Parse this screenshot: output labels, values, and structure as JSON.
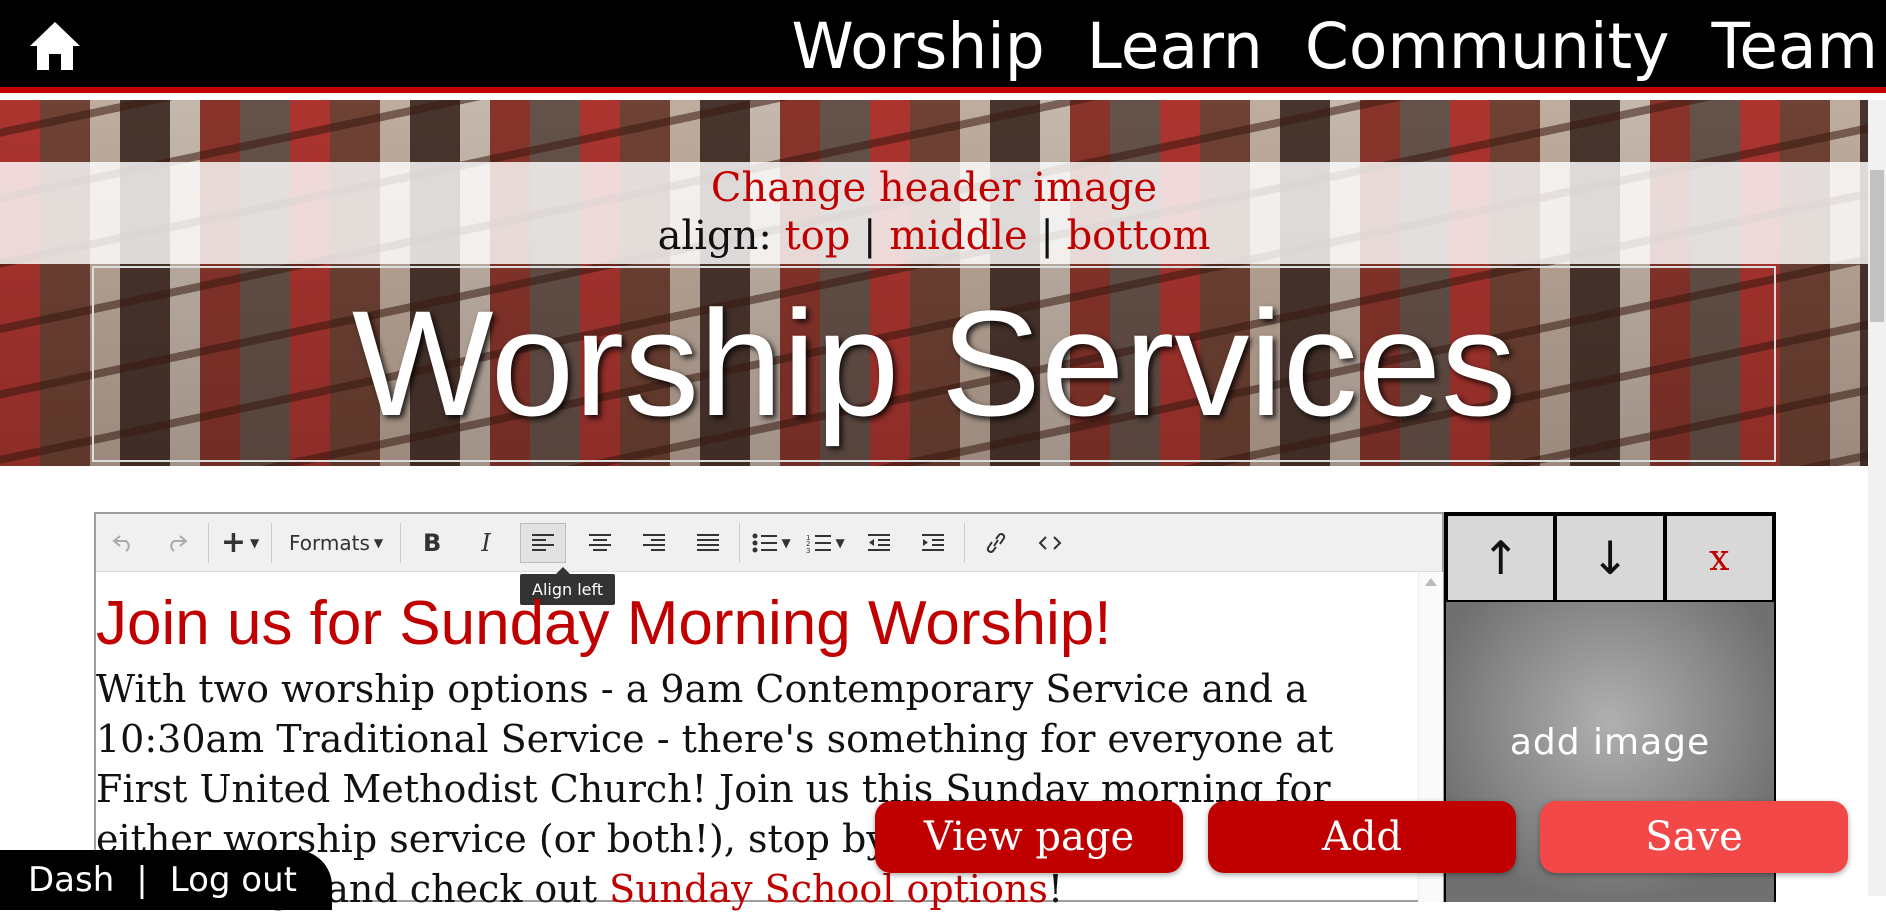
{
  "nav": {
    "home_icon": "home-icon",
    "links": [
      "Worship",
      "Learn",
      "Community",
      "Team"
    ]
  },
  "header": {
    "change_image": "Change header image",
    "align_label": "align:",
    "align_options": [
      "top",
      "middle",
      "bottom"
    ],
    "separator": "|",
    "title": "Worship Services"
  },
  "toolbar": {
    "formats": "Formats",
    "tooltip": "Align left",
    "icons": [
      "undo-icon",
      "redo-icon",
      "insert-icon",
      "bold-icon",
      "italic-icon",
      "align-left-icon",
      "align-center-icon",
      "align-right-icon",
      "justify-icon",
      "bullet-list-icon",
      "numbered-list-icon",
      "outdent-icon",
      "indent-icon",
      "link-icon",
      "source-code-icon"
    ]
  },
  "content": {
    "heading": "Join us for Sunday Morning Worship!",
    "para_lines": [
      "With two worship options - a 9am Contemporary Service and a",
      "10:30am Traditional Service - there's something for everyone at",
      "First United Methodist Church! Join us this Sunday morning for",
      "either worship service (or both!), stop by",
      "the Lounge and check out"
    ],
    "link_text": "Sunday School options",
    "after_link": "!"
  },
  "side_panel": {
    "up": "↑",
    "down": "↓",
    "close": "x",
    "add_image": "add image"
  },
  "actions": {
    "view": "View page",
    "add": "Add",
    "save": "Save"
  },
  "admin": {
    "dash": "Dash",
    "sep": "|",
    "logout": "Log out"
  },
  "colors": {
    "brand_red": "#c00000",
    "save_red": "#f24848",
    "nav_bg": "#000000"
  }
}
